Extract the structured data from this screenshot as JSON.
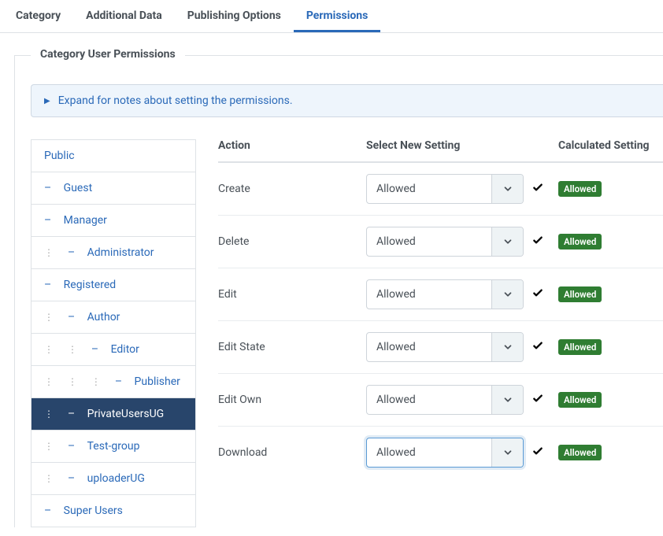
{
  "tabs": [
    {
      "label": "Category",
      "active": false
    },
    {
      "label": "Additional Data",
      "active": false
    },
    {
      "label": "Publishing Options",
      "active": false
    },
    {
      "label": "Permissions",
      "active": true
    }
  ],
  "fieldset_title": "Category User Permissions",
  "notes_label": "Expand for notes about setting the permissions.",
  "groups": [
    {
      "label": "Public",
      "depth": 0,
      "active": false
    },
    {
      "label": "Guest",
      "depth": 1,
      "active": false
    },
    {
      "label": "Manager",
      "depth": 1,
      "active": false
    },
    {
      "label": "Administrator",
      "depth": 2,
      "active": false
    },
    {
      "label": "Registered",
      "depth": 1,
      "active": false
    },
    {
      "label": "Author",
      "depth": 2,
      "active": false
    },
    {
      "label": "Editor",
      "depth": 3,
      "active": false
    },
    {
      "label": "Publisher",
      "depth": 4,
      "active": false
    },
    {
      "label": "PrivateUsersUG",
      "depth": 2,
      "active": true
    },
    {
      "label": "Test-group",
      "depth": 2,
      "active": false
    },
    {
      "label": "uploaderUG",
      "depth": 2,
      "active": false
    },
    {
      "label": "Super Users",
      "depth": 1,
      "active": false
    }
  ],
  "columns": {
    "action": "Action",
    "setting": "Select New Setting",
    "calc": "Calculated Setting"
  },
  "rows": [
    {
      "action": "Create",
      "setting": "Allowed",
      "calc": "Allowed",
      "focused": false
    },
    {
      "action": "Delete",
      "setting": "Allowed",
      "calc": "Allowed",
      "focused": false
    },
    {
      "action": "Edit",
      "setting": "Allowed",
      "calc": "Allowed",
      "focused": false
    },
    {
      "action": "Edit State",
      "setting": "Allowed",
      "calc": "Allowed",
      "focused": false
    },
    {
      "action": "Edit Own",
      "setting": "Allowed",
      "calc": "Allowed",
      "focused": false
    },
    {
      "action": "Download",
      "setting": "Allowed",
      "calc": "Allowed",
      "focused": true
    }
  ]
}
